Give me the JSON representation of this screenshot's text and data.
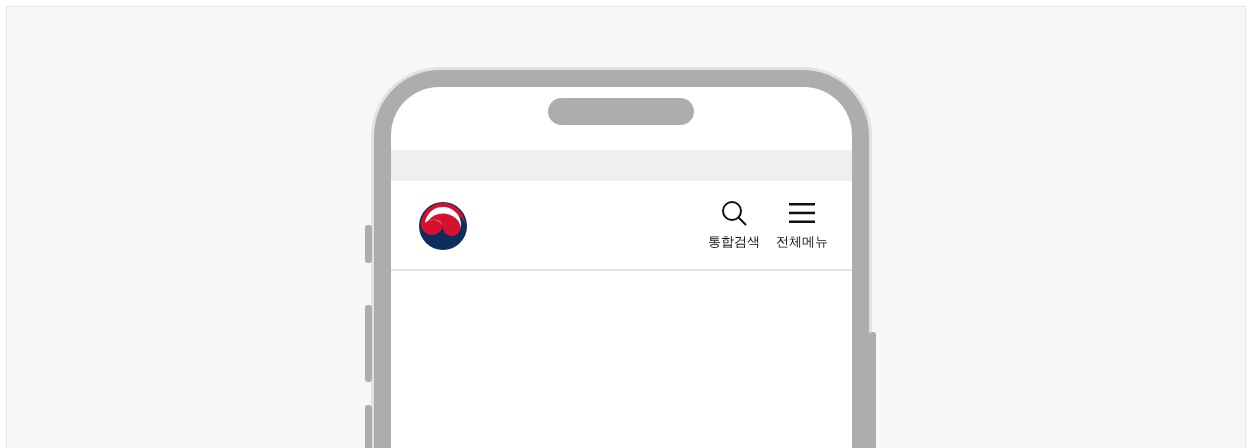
{
  "header": {
    "actions": [
      {
        "kind": "search",
        "label": "통합검색"
      },
      {
        "kind": "menu",
        "label": "전체메뉴"
      }
    ]
  }
}
